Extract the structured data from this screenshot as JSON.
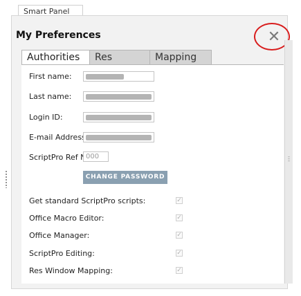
{
  "panel": {
    "tab_label": "Smart Panel",
    "title": "My Preferences",
    "close_glyph": "✕",
    "close_icon": "close-icon"
  },
  "tabs": [
    {
      "label": "Authorities",
      "active": true
    },
    {
      "label": "Res Windows",
      "active": false
    },
    {
      "label": "Mapping",
      "active": false
    }
  ],
  "form": {
    "first_name_label": "First name:",
    "last_name_label": "Last name:",
    "login_id_label": "Login ID:",
    "email_label": "E-mail Address:",
    "ref_no_label": "ScriptPro Ref No:",
    "ref_no_placeholder": "000",
    "change_password_label": "CHANGE PASSWORD"
  },
  "permissions": [
    {
      "label": "Get standard ScriptPro scripts:",
      "checked": true
    },
    {
      "label": "Office Macro Editor:",
      "checked": true
    },
    {
      "label": "Office Manager:",
      "checked": true
    },
    {
      "label": "ScriptPro Editing:",
      "checked": true
    },
    {
      "label": "Res Window Mapping:",
      "checked": true
    }
  ],
  "colors": {
    "highlight_ring": "#d81c1c",
    "button_bg": "#8aa0b1"
  }
}
